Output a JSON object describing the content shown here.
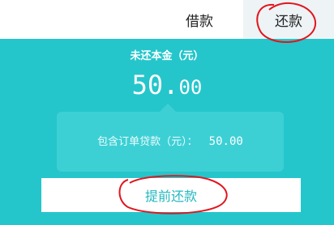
{
  "header": {
    "tabs": [
      {
        "label": "借款",
        "active": false
      },
      {
        "label": "还款",
        "active": true
      }
    ]
  },
  "summary": {
    "principal_label": "未还本金（元）",
    "principal_int": "50.",
    "principal_dec": "00"
  },
  "tip": {
    "label": "包含订单贷款（元）：",
    "value": "50.00"
  },
  "actions": {
    "early_repay_label": "提前还款"
  },
  "colors": {
    "primary": "#24c6cb",
    "tip_bg": "#3cd0d5",
    "button_text": "#24b8c0",
    "annotation": "#e0161e"
  }
}
